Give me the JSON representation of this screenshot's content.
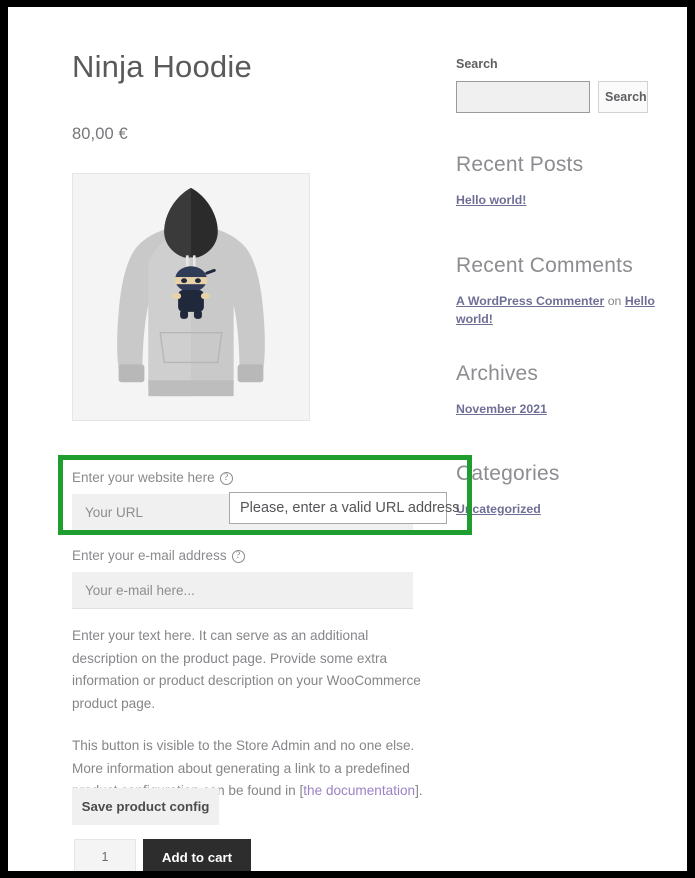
{
  "product": {
    "title": "Ninja Hoodie",
    "price": "80,00 €",
    "image_alt": "ninja-hoodie-image"
  },
  "website_field": {
    "label": "Enter your website here",
    "help_icon": "question-mark-circle-icon",
    "placeholder": "Your URL",
    "value": ""
  },
  "validation_tooltip": {
    "message": "Please, enter a valid URL address"
  },
  "email_field": {
    "label": "Enter your e-mail address",
    "help_icon": "question-mark-circle-icon",
    "placeholder": "Your e-mail here...",
    "value": ""
  },
  "descriptions": {
    "paragraph1": "Enter your text here. It can serve as an additional description on the product page. Provide some extra information or product description on your WooCommerce product page.",
    "paragraph2_before": "This button is visible to the Store Admin and no one else. More information about generating a link to a predefined product configuration can be found in [",
    "paragraph2_link": "the documentation",
    "paragraph2_after": "]."
  },
  "buttons": {
    "save_config": "Save product config",
    "add_to_cart": "Add to cart",
    "quantity": "1"
  },
  "sidebar": {
    "search": {
      "title": "Search",
      "placeholder": "",
      "value": "",
      "submit_label": "Search"
    },
    "recent_posts": {
      "title": "Recent Posts",
      "items": [
        "Hello world!"
      ]
    },
    "recent_comments": {
      "title": "Recent Comments",
      "author": "A WordPress Commenter",
      "connector": " on ",
      "post": "Hello world!"
    },
    "archives": {
      "title": "Archives",
      "items": [
        "November 2021"
      ]
    },
    "categories": {
      "title": "Categories",
      "items": [
        "Uncategorized"
      ]
    }
  },
  "colors": {
    "highlight_green": "#1f9d2e",
    "link_purple": "#9b82c4",
    "button_dark": "#2d2d2d",
    "frame_black": "#000000"
  }
}
